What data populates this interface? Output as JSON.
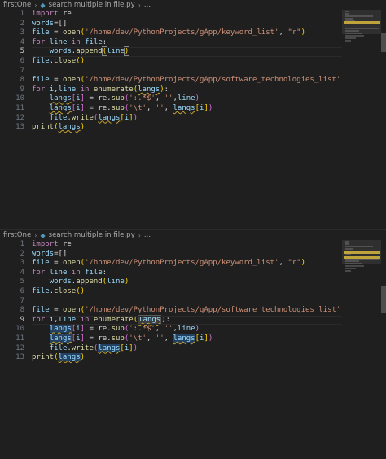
{
  "panes": [
    {
      "breadcrumb": {
        "folder": "firstOne",
        "file": "search multiple in file.py",
        "ellipsis": "..."
      },
      "line_numbers": [
        "1",
        "2",
        "3",
        "4",
        "5",
        "6",
        "7",
        "8",
        "9",
        "10",
        "11",
        "12",
        "13"
      ],
      "active_line": 5,
      "lines": [
        [
          {
            "t": "import ",
            "c": "kw"
          },
          {
            "t": "re",
            "c": "pl"
          }
        ],
        [
          {
            "t": "words",
            "c": "var"
          },
          {
            "t": "=[]",
            "c": "pl"
          }
        ],
        [
          {
            "t": "file",
            "c": "var"
          },
          {
            "t": " = ",
            "c": "pl"
          },
          {
            "t": "open",
            "c": "fn"
          },
          {
            "t": "(",
            "c": "bracket"
          },
          {
            "t": "'/home/dev/PythonProjects/gApp/keyword_list'",
            "c": "str"
          },
          {
            "t": ", ",
            "c": "pl"
          },
          {
            "t": "\"r\"",
            "c": "str"
          },
          {
            "t": ")",
            "c": "bracket"
          }
        ],
        [
          {
            "t": "for ",
            "c": "kw"
          },
          {
            "t": "line",
            "c": "var"
          },
          {
            "t": " in ",
            "c": "kw"
          },
          {
            "t": "file",
            "c": "var"
          },
          {
            "t": ":",
            "c": "pl"
          }
        ],
        [
          {
            "t": "    ",
            "c": "pl"
          },
          {
            "t": "words",
            "c": "var"
          },
          {
            "t": ".",
            "c": "pl"
          },
          {
            "t": "append",
            "c": "fn"
          },
          {
            "t": "(",
            "c": "bracket cursor-box"
          },
          {
            "t": "line",
            "c": "var"
          },
          {
            "t": ")",
            "c": "bracket cursor-box"
          }
        ],
        [
          {
            "t": "file",
            "c": "var"
          },
          {
            "t": ".",
            "c": "pl"
          },
          {
            "t": "close",
            "c": "fn"
          },
          {
            "t": "()",
            "c": "bracket"
          }
        ],
        [],
        [
          {
            "t": "file",
            "c": "var"
          },
          {
            "t": " = ",
            "c": "pl"
          },
          {
            "t": "open",
            "c": "fn"
          },
          {
            "t": "(",
            "c": "bracket"
          },
          {
            "t": "'/home/dev/PythonProjects/gApp/software_technologies_list'",
            "c": "str"
          },
          {
            "t": ", ",
            "c": "pl"
          },
          {
            "t": "\"w",
            "c": "str"
          }
        ],
        [
          {
            "t": "for ",
            "c": "kw"
          },
          {
            "t": "i",
            "c": "var"
          },
          {
            "t": ",",
            "c": "pl"
          },
          {
            "t": "line",
            "c": "var"
          },
          {
            "t": " in ",
            "c": "kw"
          },
          {
            "t": "enumerate",
            "c": "fn"
          },
          {
            "t": "(",
            "c": "bracket"
          },
          {
            "t": "langs",
            "c": "var squiggle"
          },
          {
            "t": ")",
            "c": "bracket"
          },
          {
            "t": ":",
            "c": "pl"
          }
        ],
        [
          {
            "t": "    ",
            "c": "pl"
          },
          {
            "t": "langs",
            "c": "var squiggle"
          },
          {
            "t": "[",
            "c": "bracket2"
          },
          {
            "t": "i",
            "c": "var"
          },
          {
            "t": "]",
            "c": "bracket2"
          },
          {
            "t": " = ",
            "c": "pl"
          },
          {
            "t": "re",
            "c": "pl"
          },
          {
            "t": ".",
            "c": "pl"
          },
          {
            "t": "sub",
            "c": "fn"
          },
          {
            "t": "(",
            "c": "bracket2"
          },
          {
            "t": "':.*$'",
            "c": "str"
          },
          {
            "t": ", ",
            "c": "pl"
          },
          {
            "t": "''",
            "c": "str"
          },
          {
            "t": ",",
            "c": "pl"
          },
          {
            "t": "line",
            "c": "var"
          },
          {
            "t": ")",
            "c": "bracket2"
          }
        ],
        [
          {
            "t": "    ",
            "c": "pl"
          },
          {
            "t": "langs",
            "c": "var squiggle"
          },
          {
            "t": "[",
            "c": "bracket2"
          },
          {
            "t": "i",
            "c": "var"
          },
          {
            "t": "]",
            "c": "bracket2"
          },
          {
            "t": " = ",
            "c": "pl"
          },
          {
            "t": "re",
            "c": "pl"
          },
          {
            "t": ".",
            "c": "pl"
          },
          {
            "t": "sub",
            "c": "fn"
          },
          {
            "t": "(",
            "c": "bracket2"
          },
          {
            "t": "'\\t'",
            "c": "str"
          },
          {
            "t": ", ",
            "c": "pl"
          },
          {
            "t": "''",
            "c": "str"
          },
          {
            "t": ", ",
            "c": "pl"
          },
          {
            "t": "langs",
            "c": "var squiggle"
          },
          {
            "t": "[",
            "c": "bracket"
          },
          {
            "t": "i",
            "c": "var"
          },
          {
            "t": "]",
            "c": "bracket"
          },
          {
            "t": ")",
            "c": "bracket2"
          }
        ],
        [
          {
            "t": "    ",
            "c": "pl"
          },
          {
            "t": "file",
            "c": "var"
          },
          {
            "t": ".",
            "c": "pl"
          },
          {
            "t": "write",
            "c": "fn"
          },
          {
            "t": "(",
            "c": "bracket2"
          },
          {
            "t": "langs",
            "c": "var squiggle"
          },
          {
            "t": "[",
            "c": "bracket"
          },
          {
            "t": "i",
            "c": "var"
          },
          {
            "t": "]",
            "c": "bracket"
          },
          {
            "t": ")",
            "c": "bracket2"
          }
        ],
        [
          {
            "t": "print",
            "c": "fn"
          },
          {
            "t": "(",
            "c": "bracket"
          },
          {
            "t": "langs",
            "c": "var squiggle"
          },
          {
            "t": ")",
            "c": "bracket"
          }
        ]
      ]
    },
    {
      "breadcrumb": {
        "folder": "firstOne",
        "file": "search multiple in file.py",
        "ellipsis": "..."
      },
      "line_numbers": [
        "1",
        "2",
        "3",
        "4",
        "5",
        "6",
        "7",
        "8",
        "9",
        "10",
        "11",
        "12",
        "13"
      ],
      "active_line": 9,
      "lines": [
        [
          {
            "t": "import ",
            "c": "kw"
          },
          {
            "t": "re",
            "c": "pl"
          }
        ],
        [
          {
            "t": "words",
            "c": "var"
          },
          {
            "t": "=[]",
            "c": "pl"
          }
        ],
        [
          {
            "t": "file",
            "c": "var"
          },
          {
            "t": " = ",
            "c": "pl"
          },
          {
            "t": "open",
            "c": "fn"
          },
          {
            "t": "(",
            "c": "bracket"
          },
          {
            "t": "'/home/dev/PythonProjects/gApp/keyword_list'",
            "c": "str"
          },
          {
            "t": ", ",
            "c": "pl"
          },
          {
            "t": "\"r\"",
            "c": "str"
          },
          {
            "t": ")",
            "c": "bracket"
          }
        ],
        [
          {
            "t": "for ",
            "c": "kw"
          },
          {
            "t": "line",
            "c": "var"
          },
          {
            "t": " in ",
            "c": "kw"
          },
          {
            "t": "file",
            "c": "var"
          },
          {
            "t": ":",
            "c": "pl"
          }
        ],
        [
          {
            "t": "    ",
            "c": "pl"
          },
          {
            "t": "words",
            "c": "var"
          },
          {
            "t": ".",
            "c": "pl"
          },
          {
            "t": "append",
            "c": "fn"
          },
          {
            "t": "(",
            "c": "bracket"
          },
          {
            "t": "line",
            "c": "var"
          },
          {
            "t": ")",
            "c": "bracket"
          }
        ],
        [
          {
            "t": "file",
            "c": "var"
          },
          {
            "t": ".",
            "c": "pl"
          },
          {
            "t": "close",
            "c": "fn"
          },
          {
            "t": "()",
            "c": "bracket"
          }
        ],
        [],
        [
          {
            "t": "file",
            "c": "var"
          },
          {
            "t": " = ",
            "c": "pl"
          },
          {
            "t": "open",
            "c": "fn"
          },
          {
            "t": "(",
            "c": "bracket"
          },
          {
            "t": "'/home/dev/PythonProjects/gApp/software_technologies_list'",
            "c": "str"
          },
          {
            "t": ", ",
            "c": "pl"
          },
          {
            "t": "\"w",
            "c": "str"
          }
        ],
        [
          {
            "t": "for ",
            "c": "kw"
          },
          {
            "t": "i",
            "c": "var"
          },
          {
            "t": ",",
            "c": "pl"
          },
          {
            "t": "line",
            "c": "var"
          },
          {
            "t": " in ",
            "c": "kw"
          },
          {
            "t": "enumerate",
            "c": "fn"
          },
          {
            "t": "(",
            "c": "bracket"
          },
          {
            "t": "langs",
            "c": "var hl-word squiggle"
          },
          {
            "t": ")",
            "c": "bracket"
          },
          {
            "t": ":",
            "c": "pl"
          }
        ],
        [
          {
            "t": "    ",
            "c": "pl"
          },
          {
            "t": "langs",
            "c": "var hl-sel squiggle"
          },
          {
            "t": "[",
            "c": "bracket2"
          },
          {
            "t": "i",
            "c": "var"
          },
          {
            "t": "]",
            "c": "bracket2"
          },
          {
            "t": " = ",
            "c": "pl"
          },
          {
            "t": "re",
            "c": "pl"
          },
          {
            "t": ".",
            "c": "pl"
          },
          {
            "t": "sub",
            "c": "fn"
          },
          {
            "t": "(",
            "c": "bracket2"
          },
          {
            "t": "':.*$'",
            "c": "str"
          },
          {
            "t": ", ",
            "c": "pl"
          },
          {
            "t": "''",
            "c": "str"
          },
          {
            "t": ",",
            "c": "pl"
          },
          {
            "t": "line",
            "c": "var"
          },
          {
            "t": ")",
            "c": "bracket2"
          }
        ],
        [
          {
            "t": "    ",
            "c": "pl"
          },
          {
            "t": "langs",
            "c": "var hl-sel squiggle"
          },
          {
            "t": "[",
            "c": "bracket2"
          },
          {
            "t": "i",
            "c": "var"
          },
          {
            "t": "]",
            "c": "bracket2"
          },
          {
            "t": " = ",
            "c": "pl"
          },
          {
            "t": "re",
            "c": "pl"
          },
          {
            "t": ".",
            "c": "pl"
          },
          {
            "t": "sub",
            "c": "fn"
          },
          {
            "t": "(",
            "c": "bracket2"
          },
          {
            "t": "'\\t'",
            "c": "str"
          },
          {
            "t": ", ",
            "c": "pl"
          },
          {
            "t": "''",
            "c": "str"
          },
          {
            "t": ", ",
            "c": "pl"
          },
          {
            "t": "langs",
            "c": "var hl-sel squiggle"
          },
          {
            "t": "[",
            "c": "bracket"
          },
          {
            "t": "i",
            "c": "var"
          },
          {
            "t": "]",
            "c": "bracket"
          },
          {
            "t": ")",
            "c": "bracket2"
          }
        ],
        [
          {
            "t": "    ",
            "c": "pl"
          },
          {
            "t": "file",
            "c": "var"
          },
          {
            "t": ".",
            "c": "pl"
          },
          {
            "t": "write",
            "c": "fn"
          },
          {
            "t": "(",
            "c": "bracket2"
          },
          {
            "t": "langs",
            "c": "var hl-sel squiggle"
          },
          {
            "t": "[",
            "c": "bracket"
          },
          {
            "t": "i",
            "c": "var"
          },
          {
            "t": "]",
            "c": "bracket"
          },
          {
            "t": ")",
            "c": "bracket2"
          }
        ],
        [
          {
            "t": "print",
            "c": "fn"
          },
          {
            "t": "(",
            "c": "bracket"
          },
          {
            "t": "langs",
            "c": "var hl-sel squiggle"
          },
          {
            "t": ")",
            "c": "bracket"
          }
        ]
      ]
    }
  ],
  "colors": {
    "background": "#1f1f1f",
    "keyword": "#c586c0",
    "function": "#dcdcaa",
    "variable": "#9cdcfe",
    "string": "#ce9178",
    "bracket_gold": "#ffd700",
    "bracket_orchid": "#da70d6",
    "squiggle": "#c5a332"
  },
  "icons": {
    "separator": "chevron-right-icon",
    "file_type": "python-file-icon"
  }
}
